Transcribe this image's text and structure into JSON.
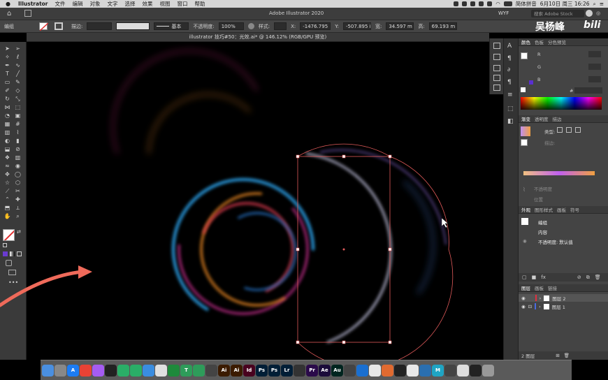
{
  "menubar": {
    "app_name": "Illustrator",
    "items": [
      "文件",
      "编辑",
      "对象",
      "文字",
      "选择",
      "效果",
      "视图",
      "窗口",
      "帮助"
    ],
    "input_method": "简体拼音",
    "datetime": "6月10日 周三 16:26"
  },
  "appbar": {
    "title": "Adobe Illustrator 2020",
    "workspace": "WYF",
    "search_placeholder": "搜索 Adobe Stock"
  },
  "control_bar": {
    "group_label": "编组",
    "stroke_label": "描边:",
    "stroke_style": "基本",
    "opacity_label": "不透明度:",
    "opacity_value": "100%",
    "style_label": "样式:",
    "x_label": "X:",
    "x_value": "-1476.795",
    "y_label": "Y:",
    "y_value": "-507.895 i",
    "w_label": "宽:",
    "w_value": "34.597 m",
    "h_label": "高:",
    "h_value": "69.193 m"
  },
  "document_tab": {
    "title": "illustrator 技巧#50：光效.ai* @ 146.12% (RGB/GPU 预览)"
  },
  "watermark": {
    "author": "吴杨峰",
    "logo": "bili"
  },
  "panels": {
    "color_tabs": [
      "颜色",
      "色板",
      "分色预览"
    ],
    "channels": [
      "R",
      "G",
      "B"
    ],
    "hex_symbol": "#",
    "gradient_tabs": [
      "渐变",
      "透明度",
      "描边"
    ],
    "gradient_type_label": "类型:",
    "gradient_stroke_label": "描边:",
    "gradient_opacity_label": "不透明度",
    "gradient_location_label": "位置",
    "appearance_tabs": [
      "外观",
      "图形样式",
      "画板",
      "符号"
    ],
    "appearance_items": [
      "编组",
      "内容",
      "不透明度: 默认值"
    ],
    "layers_tabs": [
      "图层",
      "画板",
      "链接"
    ],
    "layers": [
      "图层 2",
      "图层 1"
    ],
    "layer_count": "2 图层"
  },
  "dock": {
    "apps": [
      {
        "label": "",
        "color": "#4a8fe0"
      },
      {
        "label": "",
        "color": "#888"
      },
      {
        "label": "A",
        "color": "#1c7cf4"
      },
      {
        "label": "",
        "color": "#e94235"
      },
      {
        "label": "",
        "color": "#a55cf2"
      },
      {
        "label": "",
        "color": "#222"
      },
      {
        "label": "",
        "color": "#2aae67"
      },
      {
        "label": "",
        "color": "#2aae67"
      },
      {
        "label": "",
        "color": "#3a8de0"
      },
      {
        "label": "",
        "color": "#e0e0e0"
      },
      {
        "label": "",
        "color": "#1e8a3b"
      },
      {
        "label": "T",
        "color": "#2e9c5a"
      },
      {
        "label": "",
        "color": "#2e9c5a"
      },
      {
        "label": "",
        "color": "#444"
      },
      {
        "label": "Ai",
        "color": "#3b1b00"
      },
      {
        "label": "Ai",
        "color": "#3b1b00"
      },
      {
        "label": "Id",
        "color": "#49021f"
      },
      {
        "label": "Ps",
        "color": "#001e36"
      },
      {
        "label": "Ps",
        "color": "#001e36"
      },
      {
        "label": "Lr",
        "color": "#001e36"
      },
      {
        "label": "",
        "color": "#333"
      },
      {
        "label": "Pr",
        "color": "#2a0a4a"
      },
      {
        "label": "Ae",
        "color": "#1a0b3a"
      },
      {
        "label": "Au",
        "color": "#00251f"
      },
      {
        "label": "",
        "color": "#444"
      },
      {
        "label": "",
        "color": "#1a6fd0"
      },
      {
        "label": "",
        "color": "#e8e8e8"
      },
      {
        "label": "",
        "color": "#e06a30"
      },
      {
        "label": "",
        "color": "#222"
      },
      {
        "label": "",
        "color": "#e8e8e8"
      },
      {
        "label": "",
        "color": "#2a6fb0"
      },
      {
        "label": "M",
        "color": "#1fa5c4"
      },
      {
        "label": "",
        "color": "#444"
      },
      {
        "label": "",
        "color": "#ddd"
      },
      {
        "label": "",
        "color": "#222"
      },
      {
        "label": "",
        "color": "#999"
      }
    ]
  },
  "colors": {
    "selection": "#e05a5a",
    "arrow": "#ef6a5a",
    "accent": "#ef6a5a"
  }
}
